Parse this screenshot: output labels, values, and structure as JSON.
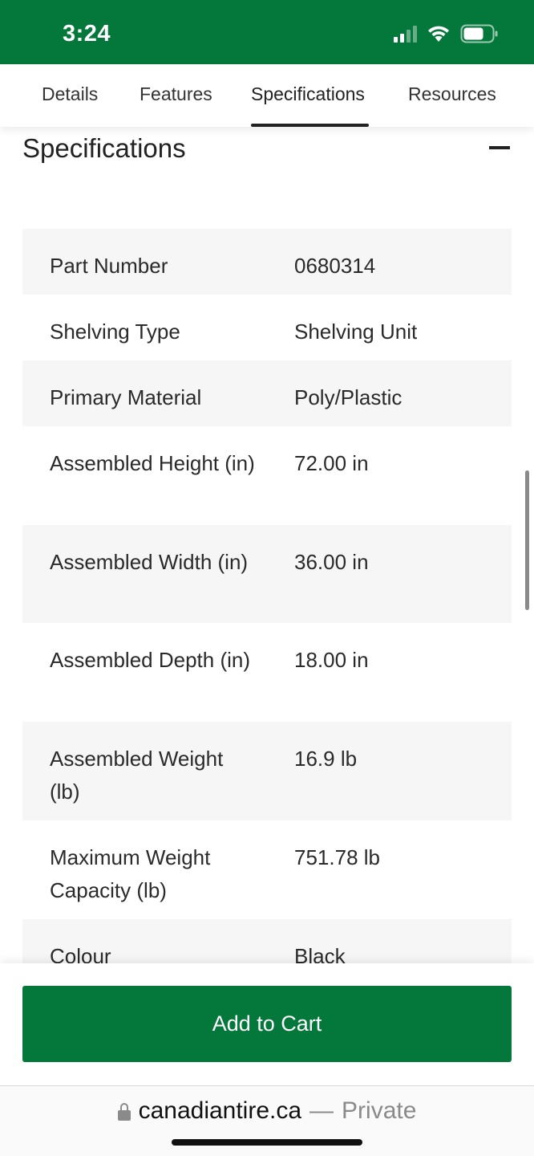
{
  "status_bar": {
    "time": "3:24",
    "icons": [
      "cellular-signal-icon",
      "wifi-icon",
      "battery-icon"
    ],
    "background": "#04773a"
  },
  "tabs": [
    {
      "label": "Details",
      "active": false
    },
    {
      "label": "Features",
      "active": false
    },
    {
      "label": "Specifications",
      "active": true
    },
    {
      "label": "Resources",
      "active": false
    }
  ],
  "section": {
    "title": "Specifications",
    "collapse_icon": "minus-icon"
  },
  "specs": [
    {
      "label": "Part Number",
      "value": "0680314"
    },
    {
      "label": "Shelving Type",
      "value": "Shelving Unit"
    },
    {
      "label": "Primary Material",
      "value": "Poly/Plastic"
    },
    {
      "label": "Assembled Height (in)",
      "value": "72.00 in"
    },
    {
      "label": "Assembled Width (in)",
      "value": "36.00 in"
    },
    {
      "label": "Assembled Depth (in)",
      "value": "18.00 in"
    },
    {
      "label": "Assembled Weight (lb)",
      "value": "16.9 lb"
    },
    {
      "label": "Maximum Weight Capacity (lb)",
      "value": "751.78 lb"
    },
    {
      "label": "Colour",
      "value": "Black"
    }
  ],
  "cart": {
    "button_label": "Add to Cart",
    "accent": "#04773a"
  },
  "browser": {
    "domain": "canadiantire.ca",
    "separator": "—",
    "mode": "Private",
    "lock_icon": "lock-icon"
  }
}
